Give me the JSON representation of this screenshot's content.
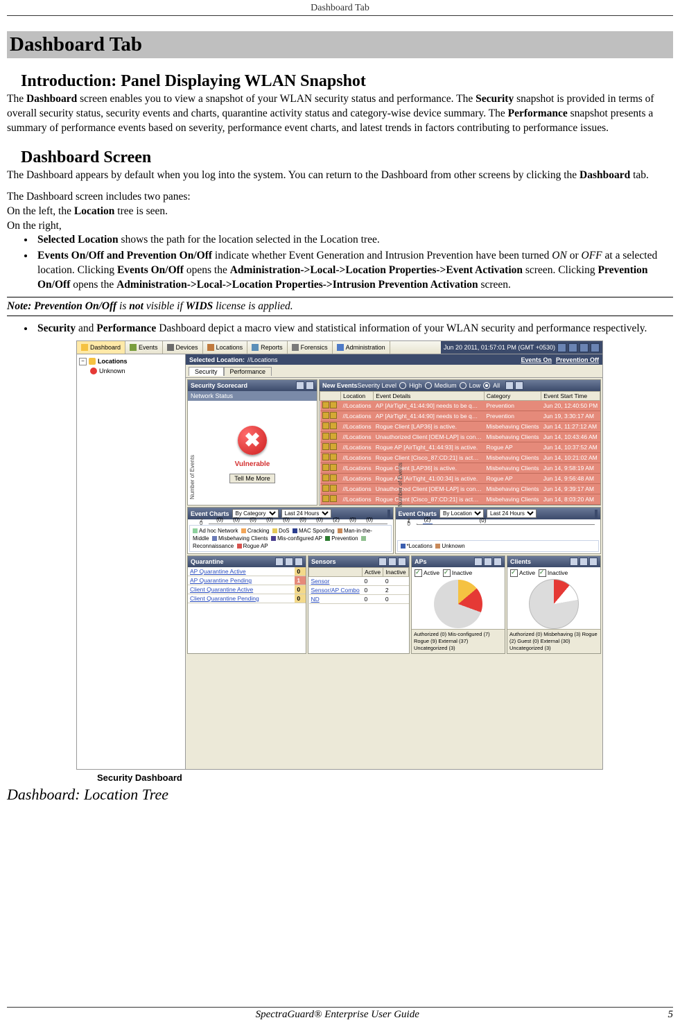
{
  "running_header": "Dashboard Tab",
  "page_number": "5",
  "footer_text": "SpectraGuard® Enterprise User Guide",
  "h1": "Dashboard Tab",
  "h2_intro": "Introduction: Panel Displaying WLAN Snapshot",
  "p_intro": {
    "t1": "The ",
    "b1": "Dashboard",
    "t2": " screen enables you to view a snapshot of your WLAN security status and performance. The ",
    "b2": "Security",
    "t3": " snapshot is provided in terms of overall security status, security events and charts, quarantine activity status and category-wise device summary. The ",
    "b3": "Performance",
    "t4": " snapshot presents a summary of performance events based on severity, performance event charts, and latest trends in factors contributing to performance issues."
  },
  "h2_screen": "Dashboard Screen",
  "p_screen1": {
    "t1": "The Dashboard appears by default when you log into the system. You can return to the Dashboard from other screens by clicking the ",
    "b1": "Dashboard",
    "t2": " tab."
  },
  "p_screen2_l1": "The Dashboard screen includes two panes:",
  "p_screen2_l2a": "On the left, the ",
  "p_screen2_l2b": "Location",
  "p_screen2_l2c": " tree is seen.",
  "p_screen2_l3": "On the right,",
  "bullet1": {
    "b1": "Selected Location",
    "t1": " shows the path for the location selected in the Location tree."
  },
  "bullet2": {
    "b1": "Events On/Off and Prevention On/Off",
    "t1": " indicate whether Event Generation and Intrusion Prevention have been turned ",
    "i1": "ON",
    "t2": " or ",
    "i2": "OFF",
    "t3": " at a selected location. Clicking ",
    "b2": "Events On/Off",
    "t4": " opens the ",
    "b3": "Administration->Local->Location Properties->Event Activation",
    "t5": " screen. Clicking ",
    "b4": "Prevention On/Off",
    "t6": " opens the ",
    "b5": "Administration->Local->Location Properties->Intrusion Prevention Activation",
    "t7": " screen."
  },
  "note": {
    "t1": "Note: Prevention On/Off",
    "t2": " is ",
    "b1": "not",
    "t3": " visible if ",
    "b2": "WIDS",
    "t4": " license is applied."
  },
  "bullet3": {
    "b1": "Security",
    "t1": " and ",
    "b2": "Performance",
    "t2": " Dashboard depict a macro view and statistical information of your WLAN security and performance respectively."
  },
  "figure_caption": "Security Dashboard",
  "h3_loc": "Dashboard: Location Tree",
  "app": {
    "topbar": {
      "tabs": [
        "Dashboard",
        "Events",
        "Devices",
        "Locations",
        "Reports",
        "Forensics",
        "Administration"
      ],
      "timestamp": "Jun 20 2011, 01:57:01 PM (GMT +0530)"
    },
    "tree": {
      "root": "Locations",
      "child": "Unknown"
    },
    "selbar": {
      "label": "Selected Location:",
      "path": "//Locations",
      "events_link": "Events On",
      "prev_link": "Prevention Off"
    },
    "subtabs": [
      "Security",
      "Performance"
    ],
    "scorecard": {
      "title": "Security Scorecard",
      "subtitle": "Network Status",
      "status": "Vulnerable",
      "button": "Tell Me More"
    },
    "new_events": {
      "title": "New Events",
      "sev_label": "Severity Level",
      "sev_opts": [
        "High",
        "Medium",
        "Low",
        "All"
      ],
      "cols": [
        "",
        "Location",
        "Event Details",
        "Category",
        "Event Start Time"
      ],
      "rows": [
        {
          "loc": "//Locations",
          "det": "AP [AirTight_41:44:90] needs to be q…",
          "cat": "Prevention",
          "time": "Jun 20, 12:40:50 PM"
        },
        {
          "loc": "//Locations",
          "det": "AP [AirTight_41:44:90] needs to be q…",
          "cat": "Prevention",
          "time": "Jun 19, 3:30:17 AM"
        },
        {
          "loc": "//Locations",
          "det": "Rogue Client [LAP36] is active.",
          "cat": "Misbehaving Clients",
          "time": "Jun 14, 11:27:12 AM"
        },
        {
          "loc": "//Locations",
          "det": "Unauthorized Client [OEM-LAP] is con…",
          "cat": "Misbehaving Clients",
          "time": "Jun 14, 10:43:46 AM"
        },
        {
          "loc": "//Locations",
          "det": "Rogue AP [AirTight_41:44:93] is active.",
          "cat": "Rogue AP",
          "time": "Jun 14, 10:37:52 AM"
        },
        {
          "loc": "//Locations",
          "det": "Rogue Client [Cisco_87:CD:21] is act…",
          "cat": "Misbehaving Clients",
          "time": "Jun 14, 10:21:02 AM"
        },
        {
          "loc": "//Locations",
          "det": "Rogue Client [LAP36] is active.",
          "cat": "Misbehaving Clients",
          "time": "Jun 14, 9:58:19 AM"
        },
        {
          "loc": "//Locations",
          "det": "Rogue AP [AirTight_41:00:34] is active.",
          "cat": "Rogue AP",
          "time": "Jun 14, 9:56:48 AM"
        },
        {
          "loc": "//Locations",
          "det": "Unauthorized Client [OEM-LAP] is con…",
          "cat": "Misbehaving Clients",
          "time": "Jun 14, 9:39:17 AM"
        },
        {
          "loc": "//Locations",
          "det": "Rogue Client [Cisco_87:CD:21] is act…",
          "cat": "Misbehaving Clients",
          "time": "Jun 14, 8:03:20 AM"
        }
      ]
    },
    "chart_left": {
      "title": "Event Charts",
      "sel1": "By Category",
      "sel2": "Last 24 Hours",
      "ylabel": "Number of Events",
      "legend": [
        "Ad hoc Network",
        "Cracking",
        "DoS",
        "MAC Spoofing",
        "Man-in-the-Middle",
        "Misbehaving Clients",
        "Mis-configured AP",
        "Prevention",
        "Reconnaissance",
        "Rogue AP"
      ]
    },
    "chart_right": {
      "title": "Event Charts",
      "sel1": "By Location",
      "sel2": "Last 24 Hours",
      "ylabel": "Number of Events",
      "legend": [
        "*Locations",
        "Unknown"
      ]
    },
    "quarantine": {
      "title": "Quarantine",
      "rows": [
        {
          "name": "AP Quarantine Active",
          "val": "0",
          "cls": "warm"
        },
        {
          "name": "AP Quarantine Pending",
          "val": "1",
          "cls": "hot"
        },
        {
          "name": "Client Quarantine Active",
          "val": "0",
          "cls": "warm"
        },
        {
          "name": "Client Quarantine Pending",
          "val": "0",
          "cls": "warm"
        }
      ]
    },
    "sensors": {
      "title": "Sensors",
      "cols": [
        "",
        "Active",
        "Inactive"
      ],
      "rows": [
        {
          "name": "Sensor",
          "a": "0",
          "i": "0"
        },
        {
          "name": "Sensor/AP Combo",
          "a": "0",
          "i": "2"
        },
        {
          "name": "ND",
          "a": "0",
          "i": "0"
        }
      ]
    },
    "aps": {
      "title": "APs",
      "chk1": "Active",
      "chk2": "Inactive",
      "legend": "Authorized (0)  Mis-configured (7)  Rogue (9)  External (37)  Uncategorized (3)"
    },
    "clients": {
      "title": "Clients",
      "chk1": "Active",
      "chk2": "Inactive",
      "legend": "Authorized (0)  Misbehaving (3)  Rogue (2)  Guest (0)  External (30)  Uncategorized (3)"
    }
  },
  "chart_data": [
    {
      "type": "bar",
      "title": "Event Charts — By Category (Last 24 Hours)",
      "ylabel": "Number of Events",
      "ylim": [
        0,
        2
      ],
      "series": [
        {
          "name": "Ad hoc Network",
          "value": 0,
          "color": "#8FD19E"
        },
        {
          "name": "Cracking",
          "value": 0,
          "color": "#F2A65A"
        },
        {
          "name": "DoS",
          "value": 0,
          "color": "#E5C85A"
        },
        {
          "name": "MAC Spoofing",
          "value": 0,
          "color": "#2C3E8F"
        },
        {
          "name": "Man-in-the-Middle",
          "value": 0,
          "color": "#C98A5A"
        },
        {
          "name": "Misbehaving Clients",
          "value": 0,
          "color": "#6B7BB8"
        },
        {
          "name": "Mis-configured AP",
          "value": 0,
          "color": "#4B3F8F"
        },
        {
          "name": "Prevention",
          "value": 2,
          "color": "#2E7D32"
        },
        {
          "name": "Reconnaissance",
          "value": 0,
          "color": "#8FBF8F"
        },
        {
          "name": "Rogue AP",
          "value": 0,
          "color": "#D9534F"
        }
      ]
    },
    {
      "type": "bar",
      "title": "Event Charts — By Location (Last 24 Hours)",
      "ylabel": "Number of Events",
      "ylim": [
        0,
        2
      ],
      "series": [
        {
          "name": "*Locations",
          "value": 2,
          "color": "#3B5FB0"
        },
        {
          "name": "Unknown",
          "value": 0,
          "color": "#C98A5A"
        }
      ]
    },
    {
      "type": "pie",
      "title": "APs",
      "series": [
        {
          "name": "Authorized",
          "value": 0,
          "color": "#8FD19E"
        },
        {
          "name": "Mis-configured",
          "value": 7,
          "color": "#F5C242"
        },
        {
          "name": "Rogue",
          "value": 9,
          "color": "#E53935"
        },
        {
          "name": "External",
          "value": 37,
          "color": "#DADADA"
        },
        {
          "name": "Uncategorized",
          "value": 3,
          "color": "#BFBFBF"
        }
      ]
    },
    {
      "type": "pie",
      "title": "Clients",
      "series": [
        {
          "name": "Authorized",
          "value": 0,
          "color": "#8FD19E"
        },
        {
          "name": "Misbehaving",
          "value": 3,
          "color": "#F5C242"
        },
        {
          "name": "Rogue",
          "value": 2,
          "color": "#E53935"
        },
        {
          "name": "Guest",
          "value": 0,
          "color": "#FFFFFF"
        },
        {
          "name": "External",
          "value": 30,
          "color": "#DADADA"
        },
        {
          "name": "Uncategorized",
          "value": 3,
          "color": "#BFBFBF"
        }
      ]
    }
  ]
}
